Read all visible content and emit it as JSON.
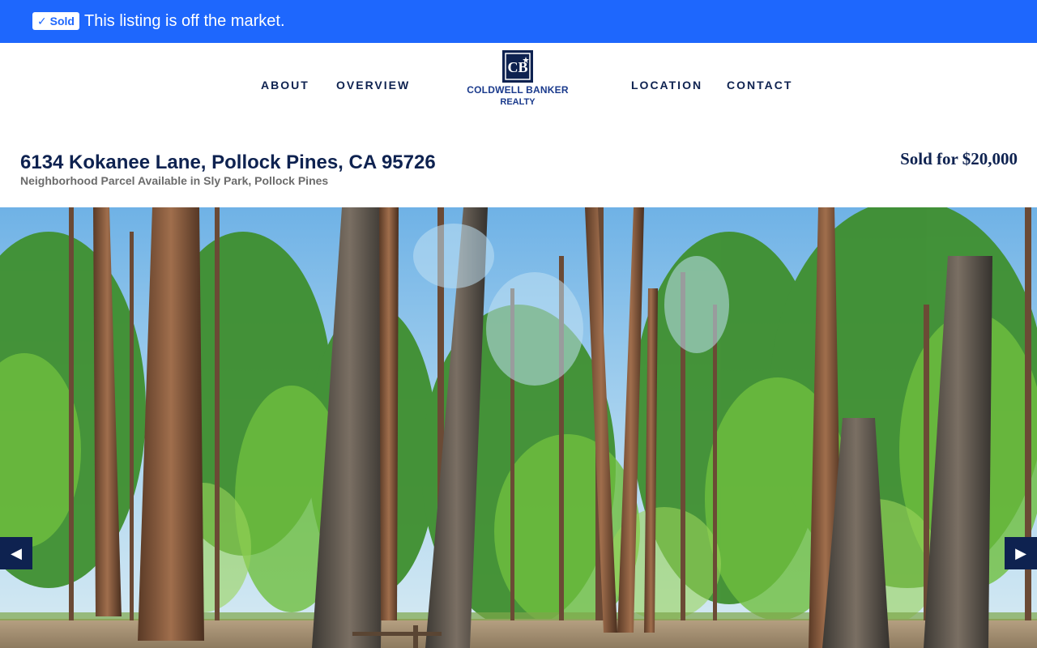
{
  "banner": {
    "badge": "✓ Sold",
    "text": "This listing is off the market.",
    "color": "#1e67fd"
  },
  "nav": {
    "items": [
      {
        "label": "ABOUT"
      },
      {
        "label": "OVERVIEW"
      },
      {
        "label": "LOCATION"
      },
      {
        "label": "CONTACT"
      }
    ]
  },
  "logo": {
    "monogram": "CB",
    "line1": "COLDWELL BANKER",
    "line2": "REALTY",
    "color": "#0e2250"
  },
  "listing": {
    "address": "6134 Kokanee Lane, Pollock Pines, CA 95726",
    "subtitle": "Neighborhood Parcel Available in Sly Park, Pollock Pines",
    "price": "Sold for $20,000"
  },
  "gallery": {
    "prev_icon": "arrow-left-icon",
    "next_icon": "arrow-right-icon",
    "prev_glyph": "◀",
    "next_glyph": "▶"
  }
}
